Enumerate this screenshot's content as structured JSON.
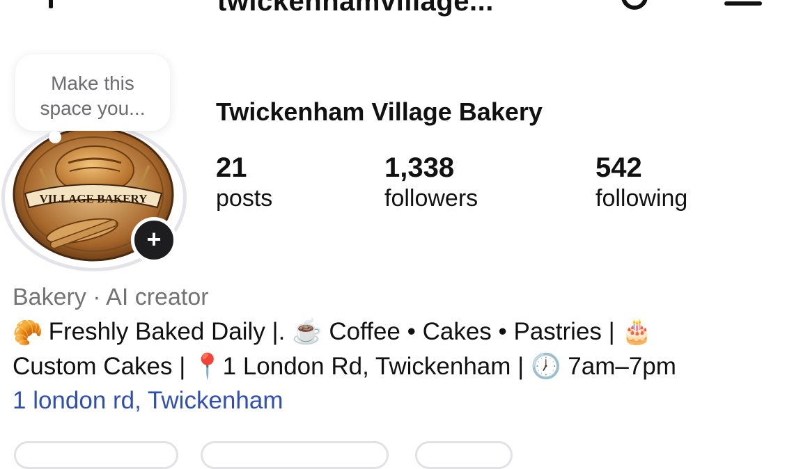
{
  "header": {
    "handle": "twickenhamvillage..."
  },
  "note": {
    "text": "Make this space you..."
  },
  "profile": {
    "display_name": "Twickenham Village Bakery",
    "avatar_text": "VILLAGE BAKERY",
    "stats": [
      {
        "value": "21",
        "label": "posts"
      },
      {
        "value": "1,338",
        "label": "followers"
      },
      {
        "value": "542",
        "label": "following"
      }
    ]
  },
  "bio": {
    "category": "Bakery · AI creator",
    "line1": "Freshly Baked Daily |. ☕ Coffee • Cakes • Pastries | 🎂",
    "line2": "Custom Cakes | 📍1 London Rd, Twickenham | 🕖 7am–7pm",
    "location_link": "1 london rd, Twickenham"
  }
}
